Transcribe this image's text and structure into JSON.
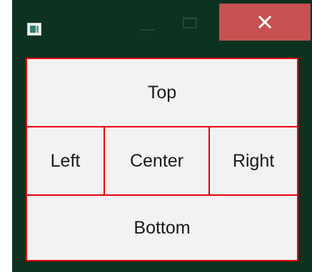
{
  "window": {
    "controls": {
      "minimize_icon": "minimize-icon",
      "maximize_icon": "maximize-icon",
      "close_icon": "close-icon",
      "close_color": "#c75050"
    },
    "background": "#0e3220"
  },
  "layout": {
    "top": "Top",
    "left": "Left",
    "center": "Center",
    "right": "Right",
    "bottom": "Bottom",
    "border_color": "#e8000d",
    "cell_background": "#f2f2f2"
  }
}
